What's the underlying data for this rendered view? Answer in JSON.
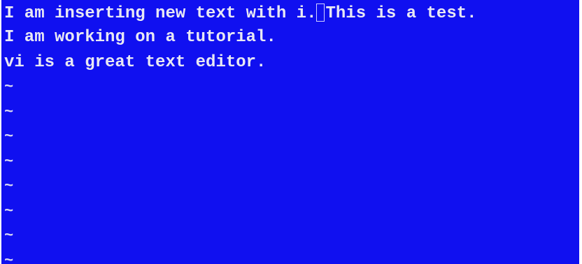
{
  "editor": {
    "background": "#1010f0",
    "foreground": "#e8e8f4",
    "lines": {
      "l0_before": "I am inserting new text with i.",
      "l0_after": "This is a test.",
      "l1": "I am working on a tutorial.",
      "l2": "vi is a great text editor."
    },
    "empty_line_marker": "~"
  }
}
